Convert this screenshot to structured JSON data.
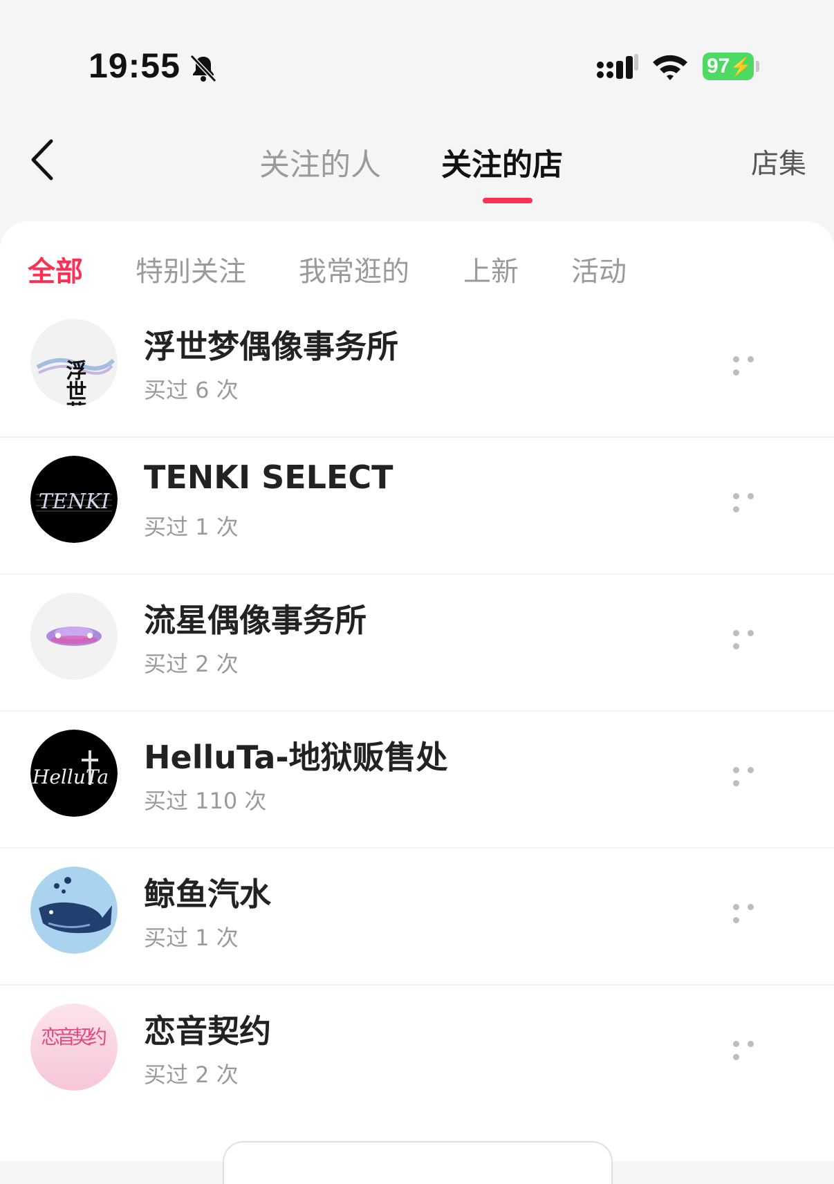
{
  "status_bar": {
    "time": "19:55",
    "battery": "97",
    "icons": [
      "bell-muted-icon",
      "signal-icon",
      "wifi-icon",
      "battery-charging-icon"
    ]
  },
  "header": {
    "back_icon": "chevron-left-icon",
    "tabs": [
      {
        "label": "关注的人",
        "active": false
      },
      {
        "label": "关注的店",
        "active": true
      }
    ],
    "right_label": "店集"
  },
  "filters": [
    {
      "label": "全部",
      "active": true
    },
    {
      "label": "特别关注",
      "active": false
    },
    {
      "label": "我常逛的",
      "active": false
    },
    {
      "label": "上新",
      "active": false
    },
    {
      "label": "活动",
      "active": false
    }
  ],
  "stores": [
    {
      "name": "浮世梦偶像事务所",
      "purchases": "买过 6 次",
      "avatar_text": "浮世夢"
    },
    {
      "name": "TENKI SELECT",
      "purchases": "买过 1 次",
      "avatar_text": "TENKI"
    },
    {
      "name": "流星偶像事务所",
      "purchases": "买过 2 次",
      "avatar_text": ""
    },
    {
      "name": "HelluTa-地狱贩售处",
      "purchases": "买过 110 次",
      "avatar_text": "HelluTa"
    },
    {
      "name": "鲸鱼汽水",
      "purchases": "买过 1 次",
      "avatar_text": ""
    },
    {
      "name": "恋音契约",
      "purchases": "买过 2 次",
      "avatar_text": "恋音契约"
    }
  ],
  "colors": {
    "accent": "#ff2e55",
    "battery": "#4cd964",
    "text_primary": "#222222",
    "text_secondary": "#9a9a9a"
  }
}
